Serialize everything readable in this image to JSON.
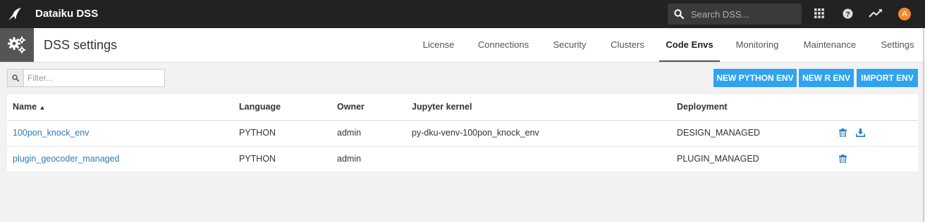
{
  "topbar": {
    "app_name": "Dataiku DSS",
    "search_placeholder": "Search DSS...",
    "avatar_initial": "A",
    "icons": [
      "bird-logo-icon",
      "search-icon",
      "apps-grid-icon",
      "help-icon",
      "activity-trend-icon"
    ]
  },
  "header": {
    "title": "DSS settings",
    "tabs": [
      {
        "label": "License",
        "active": false
      },
      {
        "label": "Connections",
        "active": false
      },
      {
        "label": "Security",
        "active": false
      },
      {
        "label": "Clusters",
        "active": false
      },
      {
        "label": "Code Envs",
        "active": true
      },
      {
        "label": "Monitoring",
        "active": false
      },
      {
        "label": "Maintenance",
        "active": false
      },
      {
        "label": "Settings",
        "active": false
      }
    ]
  },
  "toolbar": {
    "filter_placeholder": "Filter...",
    "new_python_env": "NEW PYTHON ENV",
    "new_r_env": "NEW R ENV",
    "import_env": "IMPORT ENV"
  },
  "table": {
    "columns": [
      "Name",
      "Language",
      "Owner",
      "Jupyter kernel",
      "Deployment"
    ],
    "sort_indicator": "▲",
    "rows": [
      {
        "name": "100pon_knock_env",
        "language": "PYTHON",
        "owner": "admin",
        "kernel": "py-dku-venv-100pon_knock_env",
        "deployment": "DESIGN_MANAGED",
        "actions": [
          "delete-icon",
          "download-icon"
        ]
      },
      {
        "name": "plugin_geocoder_managed",
        "language": "PYTHON",
        "owner": "admin",
        "kernel": "",
        "deployment": "PLUGIN_MANAGED",
        "actions": [
          "delete-icon"
        ]
      }
    ]
  },
  "colors": {
    "topbar_bg": "#222222",
    "accent_button": "#2fa3f0",
    "link": "#2b7bbf",
    "avatar": "#f08a2c"
  }
}
